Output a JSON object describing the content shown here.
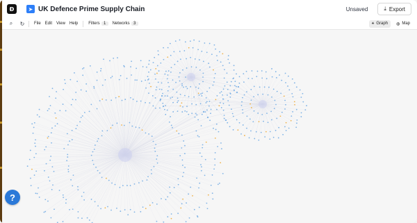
{
  "app": {
    "logo_glyph": "Đ",
    "project_icon": "paper-plane-icon",
    "project_title": "UK Defence Prime Supply Chain",
    "save_status": "Unsaved",
    "export_label": "Export"
  },
  "toolbar": {
    "menus": [
      "File",
      "Edit",
      "View",
      "Help"
    ],
    "filters_label": "Filters",
    "filters_count": "1",
    "networks_label": "Networks",
    "networks_count": "3",
    "views": [
      {
        "label": "Graph",
        "icon": "graph-icon",
        "active": true
      },
      {
        "label": "Map",
        "icon": "globe-icon",
        "active": false
      }
    ]
  },
  "graph": {
    "colors": {
      "node": "#7fb3e6",
      "accent_node": "#f0b24a",
      "edge": "#d7d9e6",
      "center_glow": "#c9cdf0"
    },
    "clusters": [
      {
        "name": "large-cluster",
        "hub": [
          177,
          180
        ],
        "rings": [
          [
            25,
            46
          ],
          [
            48,
            84
          ],
          [
            70,
            112
          ],
          [
            90,
            136
          ]
        ]
      },
      {
        "name": "top-cluster",
        "hub": [
          272,
          68
        ],
        "rings": [
          [
            12,
            18
          ],
          [
            24,
            34
          ],
          [
            36,
            50
          ],
          [
            45,
            64
          ]
        ]
      },
      {
        "name": "right-cluster",
        "hub": [
          375,
          107
        ],
        "rings": [
          [
            12,
            18
          ],
          [
            24,
            32
          ],
          [
            34,
            48
          ],
          [
            42,
            60
          ]
        ]
      }
    ]
  },
  "help": {
    "label": "?"
  }
}
